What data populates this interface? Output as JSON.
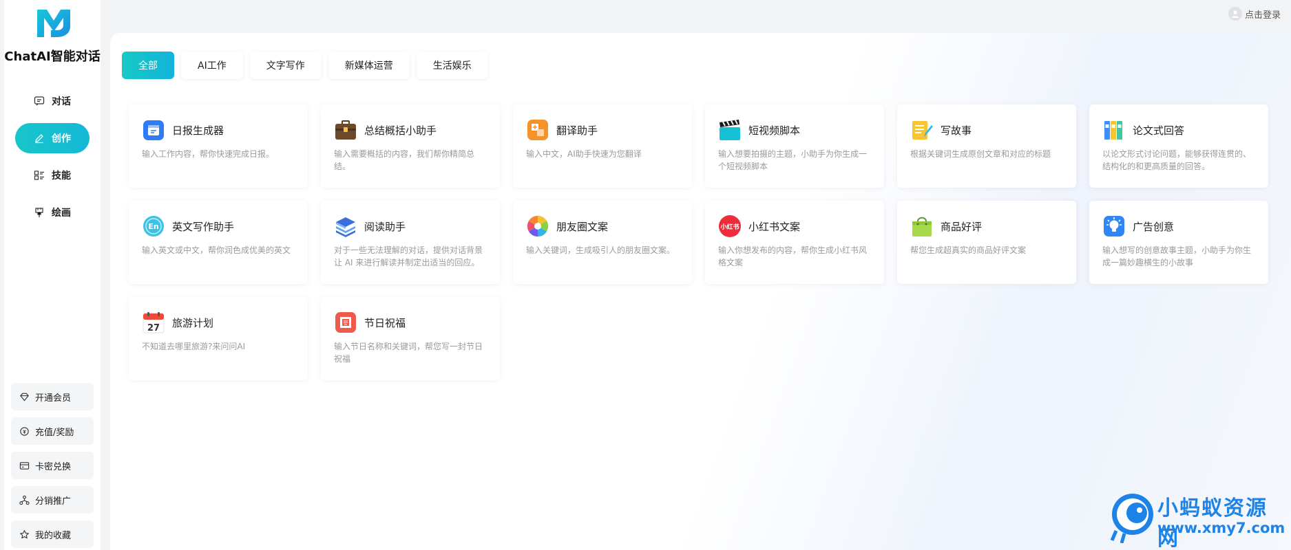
{
  "app": {
    "title": "ChatAI智能对话"
  },
  "nav": [
    {
      "label": "对话",
      "icon": "chat-icon"
    },
    {
      "label": "创作",
      "icon": "pen-icon",
      "active": true
    },
    {
      "label": "技能",
      "icon": "skills-icon"
    },
    {
      "label": "绘画",
      "icon": "brush-icon"
    }
  ],
  "bottom_menu": [
    {
      "label": "开通会员",
      "icon": "diamond-icon"
    },
    {
      "label": "充值/奖励",
      "icon": "recharge-icon"
    },
    {
      "label": "卡密兑换",
      "icon": "card-icon"
    },
    {
      "label": "分销推广",
      "icon": "share-network-icon"
    },
    {
      "label": "我的收藏",
      "icon": "star-icon"
    }
  ],
  "header": {
    "login_label": "点击登录"
  },
  "tabs": [
    {
      "label": "全部",
      "active": true
    },
    {
      "label": "AI工作"
    },
    {
      "label": "文字写作"
    },
    {
      "label": "新媒体运营"
    },
    {
      "label": "生活娱乐"
    }
  ],
  "cards": [
    {
      "title": "日报生成器",
      "desc": "输入工作内容，帮你快速完成日报。",
      "icon": "calendar-report-icon"
    },
    {
      "title": "总结概括小助手",
      "desc": "输入需要概括的内容，我们帮你精简总结。",
      "icon": "briefcase-icon"
    },
    {
      "title": "翻译助手",
      "desc": "输入中文，AI助手快速为您翻译",
      "icon": "translate-icon"
    },
    {
      "title": "短视频脚本",
      "desc": "输入想要拍摄的主题，小助手为你生成一个短视频脚本",
      "icon": "clapperboard-icon"
    },
    {
      "title": "写故事",
      "desc": "根据关键词生成原创文章和对应的标题",
      "icon": "notepad-icon"
    },
    {
      "title": "论文式回答",
      "desc": "以论文形式讨论问题，能够获得连贯的、结构化的和更高质量的回答。",
      "icon": "binders-icon"
    },
    {
      "title": "英文写作助手",
      "desc": "输入英文或中文，帮你润色成优美的英文",
      "icon": "english-icon"
    },
    {
      "title": "阅读助手",
      "desc": "对于一些无法理解的对话，提供对话背景让 AI 来进行解读并制定出适当的回应。",
      "icon": "books-icon"
    },
    {
      "title": "朋友圈文案",
      "desc": "输入关键词，生成吸引人的朋友圈文案。",
      "icon": "camera-shutter-icon"
    },
    {
      "title": "小红书文案",
      "desc": "输入你想发布的内容，帮你生成小红书风格文案",
      "icon": "xiaohongshu-icon",
      "icon_text": "小红书"
    },
    {
      "title": "商品好评",
      "desc": "帮您生成超真实的商品好评文案",
      "icon": "shopping-bag-icon"
    },
    {
      "title": "广告创意",
      "desc": "输入想写的创意故事主题，小助手为你生成一篇妙趣横生的小故事",
      "icon": "lightbulb-icon"
    },
    {
      "title": "旅游计划",
      "desc": "不知道去哪里旅游?来问问AI",
      "icon": "calendar-27-icon",
      "icon_text": "27"
    },
    {
      "title": "节日祝福",
      "desc": "输入节日名称和关键词，帮您写一封节日祝福",
      "icon": "greeting-card-icon"
    }
  ],
  "watermark": {
    "line1": "小蚂蚁资源网",
    "line2": "www.xmy7.com"
  },
  "colors": {
    "accent": "#16bfd0",
    "watermark": "#1e83e6"
  }
}
